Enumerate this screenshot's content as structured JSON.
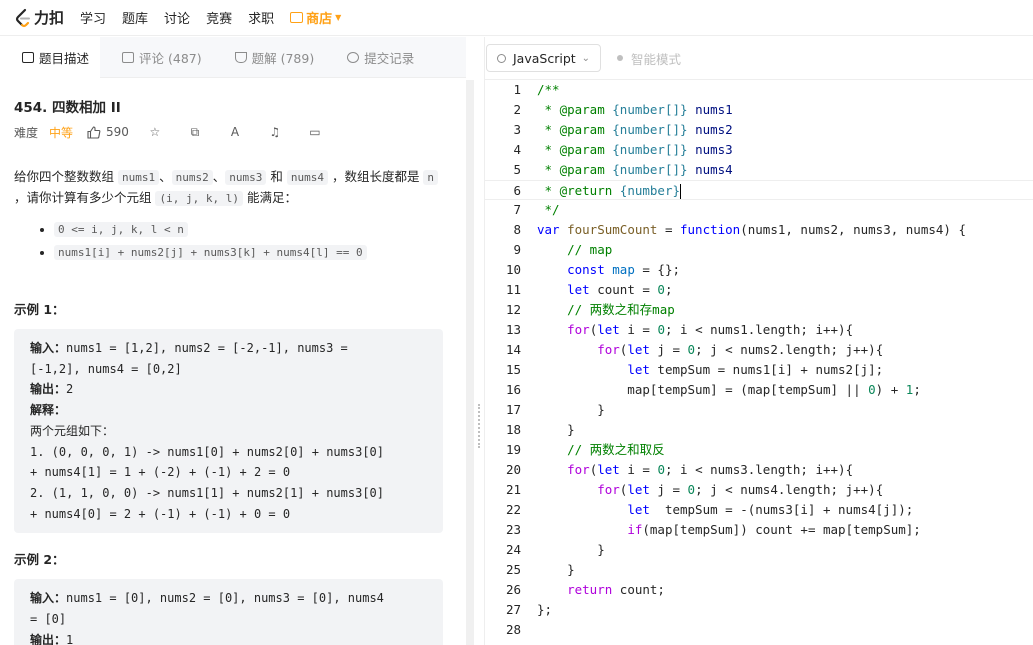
{
  "nav": {
    "logo_text": "力扣",
    "items": [
      "学习",
      "题库",
      "讨论",
      "竞赛",
      "求职"
    ],
    "store": "商店",
    "accent": "#ffa116"
  },
  "tabs": [
    {
      "label": "题目描述"
    },
    {
      "label": "评论 (487)"
    },
    {
      "label": "题解 (789)"
    },
    {
      "label": "提交记录"
    }
  ],
  "problem": {
    "title": "454. 四数相加 II",
    "difficulty_label": "难度",
    "difficulty": "中等",
    "likes": "590",
    "desc_1": "给你四个整数数组 ",
    "arr1": "nums1",
    "sep1": "、",
    "arr2": "nums2",
    "sep2": "、",
    "arr3": "nums3",
    "and": " 和 ",
    "arr4": "nums4",
    "desc_2": " ，数组长度都是 ",
    "n": "n",
    "desc_3": " ，请你计算有多少个元组 ",
    "tuple": "(i, j, k, l)",
    "desc_4": " 能满足：",
    "constraints": [
      "0 <= i, j, k, l < n",
      "nums1[i] + nums2[j] + nums3[k] + nums4[l] == 0"
    ],
    "example1_title": "示例 1：",
    "example1": {
      "input_label": "输入：",
      "input_1": "nums1 = [1,2], nums2 = [-2,-1], nums3 =",
      "input_2": "[-1,2], nums4 = [0,2]",
      "output_label": "输出：",
      "output": "2",
      "explain_label": "解释：",
      "explain_intro": "两个元组如下：",
      "line1": "1. (0, 0, 0, 1) -> nums1[0] + nums2[0] + nums3[0]",
      "line2": "+ nums4[1] = 1 + (-2) + (-1) + 2 = 0",
      "line3": "2. (1, 1, 0, 0) -> nums1[1] + nums2[1] + nums3[0]",
      "line4": "+ nums4[0] = 2 + (-1) + (-1) + 0 = 0"
    },
    "example2_title": "示例 2：",
    "example2": {
      "input_label": "输入：",
      "input_1": "nums1 = [0], nums2 = [0], nums3 = [0], nums4",
      "input_2": "= [0]",
      "output_label": "输出：",
      "output": "1"
    }
  },
  "editor": {
    "language": "JavaScript",
    "smart_mode": "智能模式",
    "line_numbers": [
      "1",
      "2",
      "3",
      "4",
      "5",
      "6",
      "7",
      "8",
      "9",
      "10",
      "11",
      "12",
      "13",
      "14",
      "15",
      "16",
      "17",
      "18",
      "19",
      "20",
      "21",
      "22",
      "23",
      "24",
      "25",
      "26",
      "27",
      "28"
    ]
  }
}
